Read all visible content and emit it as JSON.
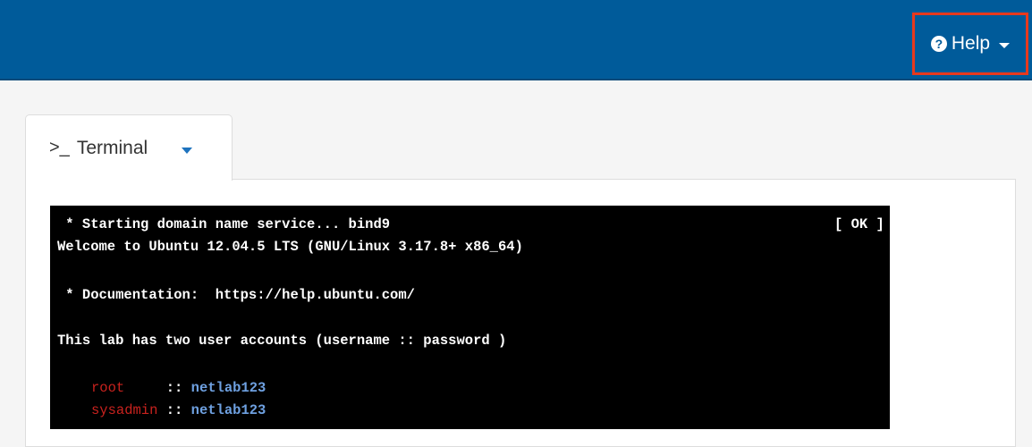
{
  "navbar": {
    "help": {
      "icon": "question-circle-icon",
      "icon_glyph": "?",
      "label": "Help"
    },
    "highlight_color": "#e8391d",
    "bg_color": "#005b9a"
  },
  "tab": {
    "icon": "terminal-prompt-icon",
    "icon_glyph": ">_",
    "label": "Terminal"
  },
  "terminal": {
    "lines": {
      "l1": " * Starting domain name service... bind9",
      "l1_status": "[ OK ]",
      "l2": "Welcome to Ubuntu 12.04.5 LTS (GNU/Linux 3.17.8+ x86_64)",
      "l3": " * Documentation:  https://help.ubuntu.com/",
      "l4": "This lab has two user accounts (username :: password )",
      "acct1_user": "root    ",
      "acct1_sep": " :: ",
      "acct1_pass": "netlab123",
      "acct2_user": "sysadmin",
      "acct2_sep": " :: ",
      "acct2_pass": "netlab123"
    },
    "colors": {
      "username": "#c9221e",
      "password": "#6ea0e0"
    }
  }
}
